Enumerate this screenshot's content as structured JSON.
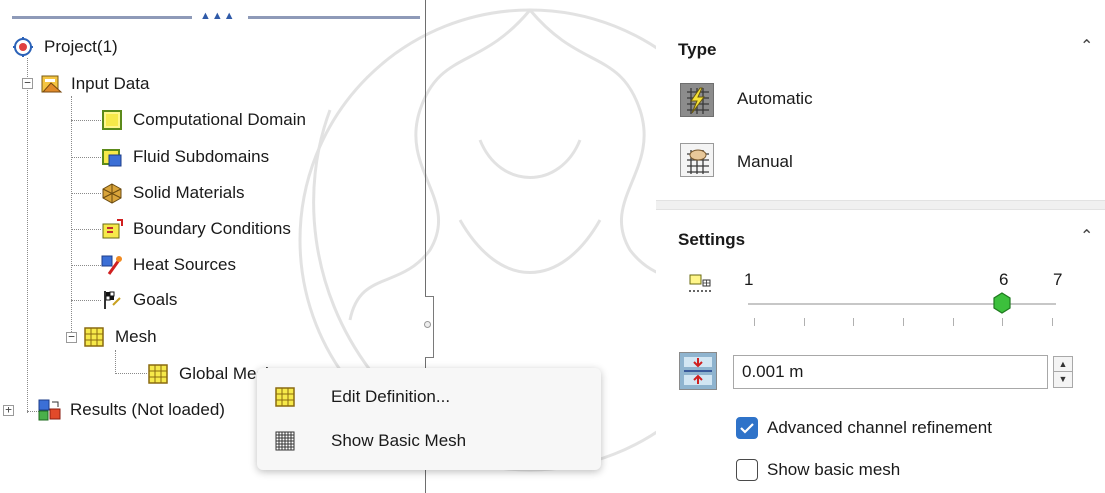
{
  "tree": {
    "root": {
      "label": "Project(1)",
      "icon": "project-icon"
    },
    "items": [
      {
        "label": "Input Data",
        "icon": "input-data-icon",
        "expander": "−"
      },
      {
        "label": "Computational Domain",
        "icon": "computational-domain-icon"
      },
      {
        "label": "Fluid Subdomains",
        "icon": "fluid-subdomains-icon"
      },
      {
        "label": "Solid Materials",
        "icon": "solid-materials-icon"
      },
      {
        "label": "Boundary Conditions",
        "icon": "boundary-conditions-icon"
      },
      {
        "label": "Heat Sources",
        "icon": "heat-sources-icon"
      },
      {
        "label": "Goals",
        "icon": "goals-icon"
      },
      {
        "label": "Mesh",
        "icon": "mesh-icon",
        "expander": "−"
      },
      {
        "label": "Global Mesh",
        "icon": "global-mesh-icon"
      },
      {
        "label": "Results (Not loaded)",
        "icon": "results-icon",
        "expander": "+"
      }
    ]
  },
  "context_menu": {
    "items": [
      {
        "label": "Edit Definition...",
        "icon": "edit-definition-icon"
      },
      {
        "label": "Show Basic Mesh",
        "icon": "basic-mesh-grid-icon"
      }
    ]
  },
  "property_panel": {
    "type_section": {
      "title": "Type",
      "options": [
        {
          "label": "Automatic",
          "selected": true,
          "icon": "automatic-mesh-icon"
        },
        {
          "label": "Manual",
          "selected": false,
          "icon": "manual-mesh-icon"
        }
      ]
    },
    "settings_section": {
      "title": "Settings",
      "slider": {
        "min_label": "1",
        "current_label": "6",
        "max_label": "7",
        "value": 6,
        "min": 1,
        "max": 7,
        "icon": "level-of-initial-mesh-icon"
      },
      "min_gap": {
        "value": "0.001 m",
        "icon": "minimum-gap-size-icon"
      },
      "checkboxes": [
        {
          "label": "Advanced channel refinement",
          "checked": true
        },
        {
          "label": "Show basic mesh",
          "checked": false
        }
      ]
    }
  },
  "colors": {
    "accent": "#2f73c9",
    "thumb": "#3cc03c"
  }
}
